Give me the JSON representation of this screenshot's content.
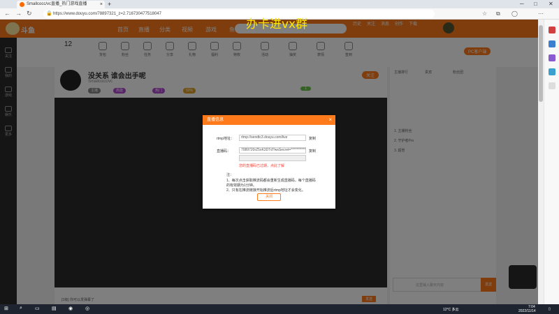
{
  "browser": {
    "tab_title": "Smallcocc/vc直播_热门游戏直播",
    "url": "https://www.douyu.com/78897321_z=2.716730477518047",
    "new_tab": "+",
    "close_tab": "×"
  },
  "overlay": {
    "text": "办卡进vx群"
  },
  "site": {
    "logo_text": "斗鱼",
    "nav": [
      "首页",
      "直播",
      "分类",
      "视频",
      "游戏",
      "鱼吧"
    ],
    "top_icons": [
      "历史",
      "关注",
      "消息",
      "创作",
      "下载"
    ]
  },
  "sidebar": {
    "items": [
      "关注",
      "我的",
      "游戏",
      "娱乐",
      "更多"
    ]
  },
  "strip": {
    "level": "12",
    "items": [
      "背包",
      "粉丝",
      "任务",
      "分享",
      "礼物",
      "福利",
      "特权",
      "活动",
      "抽奖",
      "表情",
      "签到"
    ],
    "pc_client": "PC客户端"
  },
  "room": {
    "title": "没关系 谁会出手呢",
    "streamer": "Smallcocc/vc",
    "follow_label": "关注",
    "tags": [
      "主播",
      "高能",
      "热门",
      "50%"
    ],
    "level_badge": "1"
  },
  "modal": {
    "title": "直播信息",
    "rtmp_label": "rtmp地址：",
    "rtmp_value": "rtmp://sendtc3.douyu.com/live",
    "key_label": "直播码：",
    "key_value": "7089720rZ5xK3DTd?wsSecret=**************",
    "copy_label": "复制",
    "warning": "您的直播码已过期，点此了解",
    "note_title": "注：",
    "note_1": "1、每次点击获取推流码都会重新生成直播码，每个直播码的有效期为1分钟。",
    "note_2": "2、只有在推流链接开始推流后rtmp地址才会变化。",
    "close_button": "关闭"
  },
  "right_panel": {
    "tabs": [
      "主播排行",
      "贵宾",
      "粉丝团"
    ],
    "rank_rows": [
      "1. 主播粉丝",
      "2. 守护者Pro",
      "3. 超管"
    ],
    "chat_placeholder": "这里输入聊天内容",
    "send_label": "发送"
  },
  "chat_bar": {
    "input_hint": "[1级] 你可以发弹幕了",
    "send_label": "发送"
  },
  "taskbar": {
    "weather": "12°C 多云",
    "time": "7:04",
    "date": "2022/11/14"
  },
  "colors": {
    "brand": "#ff7a1a",
    "overlay_text": "#ffe600",
    "warning": "#ff3b30",
    "link": "#1a73e8"
  }
}
